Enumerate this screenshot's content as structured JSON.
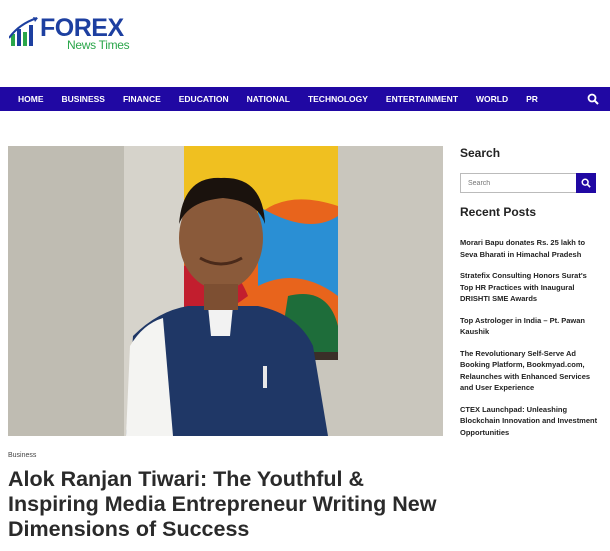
{
  "logo": {
    "brand": "FOREX",
    "tagline": "News Times"
  },
  "nav": {
    "items": [
      "HOME",
      "BUSINESS",
      "FINANCE",
      "EDUCATION",
      "NATIONAL",
      "TECHNOLOGY",
      "ENTERTAINMENT",
      "WORLD",
      "PR"
    ],
    "search_icon": "search-icon"
  },
  "article": {
    "category": "Business",
    "title": "Alok Ranjan Tiwari: The Youthful & Inspiring Media Entrepreneur Writing New Dimensions of Success"
  },
  "sidebar": {
    "search_heading": "Search",
    "search_placeholder": "Search",
    "recent_heading": "Recent Posts",
    "posts": [
      "Morari Bapu donates Rs. 25 lakh to Seva Bharati in Himachal Pradesh",
      "Stratefix Consulting Honors Surat's Top HR Practices with Inaugural DRISHTI SME Awards",
      "Top Astrologer in India – Pt. Pawan Kaushik",
      "The Revolutionary Self-Serve Ad Booking Platform, Bookmyad.com, Relaunches with Enhanced Services and User Experience",
      "CTEX Launchpad: Unleashing Blockchain Innovation and Investment Opportunities"
    ]
  },
  "colors": {
    "nav_bg": "#2008a3",
    "logo_blue": "#1d3fa0",
    "logo_green": "#2aa64a"
  }
}
